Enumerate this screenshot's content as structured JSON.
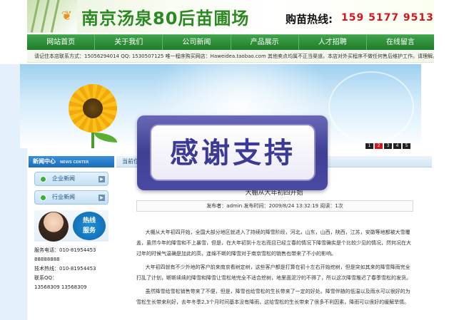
{
  "header": {
    "site_title": "南京汤泉80后苗圃场",
    "hotline_label": "购苗热线:",
    "hotline_number": "159 5177 9513"
  },
  "nav": {
    "items": [
      "网站首页",
      "关于我们",
      "公司新闻",
      "产品展示",
      "人才招聘",
      "在线留言"
    ]
  },
  "notice": {
    "text": "请记住本店联系方式：15056294014 QQ: 1530507125 唯一程序购买网店：Haweidea.taobao.com 其他卖点均属不正当渠道。本店对外买程序不做任何售后维护工作。请理解。"
  },
  "banner": {
    "pager": [
      "1",
      "2",
      "3",
      "4",
      "5"
    ],
    "active_page": "1"
  },
  "sidebar": {
    "heading": "新闻中心",
    "heading_en": "NEWS CENTER",
    "links": [
      "企业新闻",
      "行业新闻"
    ],
    "hotline_badge_line1": "热线",
    "hotline_badge_line2": "服务",
    "contact": [
      "服务电话：010-81954453",
      "88888888",
      "技术热线：010-81954453",
      "联系QQ：",
      "13568309    13568309"
    ]
  },
  "main": {
    "tab_label": "当前位置",
    "article_title": "大棚从大年初四开始",
    "meta": "发布者：admin 发布时间：2009/8/24 13:32:19 阅读：1次",
    "paragraphs": [
      "大棚从大年初四开始，全国大部分地区就进入了持续的降雪阶段，河北，山东，山西，陕西，江苏，安徽等地都被大雪覆盖，虽然今年的降雪和不上暴雪，但是，在大年初到十左右而且已经立春的情况下降雪确实是个比较少见的情况，然何况在大过年的时候气温确是加此的高，连绵不断的降雪对于南京雪松的销售也带来了不小的影响。",
      "大年初四就有不少外地的客户前来南京看树定树，这些客户都是打算在初十左右开始挖树，但是突如其来的降雪降雨完全打乱了计划，断断续续的降雪和降雪让雪松地完全不适合挖树，地里面泥泞的不得了，所以这次降雪推迟了春季雪松的发货。",
      "虽然降雪给雪松销售带来了不便，但是，降雪也给雪松的生长带来了一定的好处。降雪伴随的低温以及雨水可以很好的为雪松生长带来利好，去年冬季2,3个月时间基本没有降雨，这给雪松的生长带来了很多不利因素，降雨可以很好的缓解旱情。"
    ]
  },
  "overlay": {
    "text": "感谢支持"
  },
  "colors": {
    "brand_green": "#2b8a1f",
    "nav_green": "#1f7c2a",
    "hotline_red": "#d6141c",
    "overlay_purple": "#3f3f93"
  }
}
